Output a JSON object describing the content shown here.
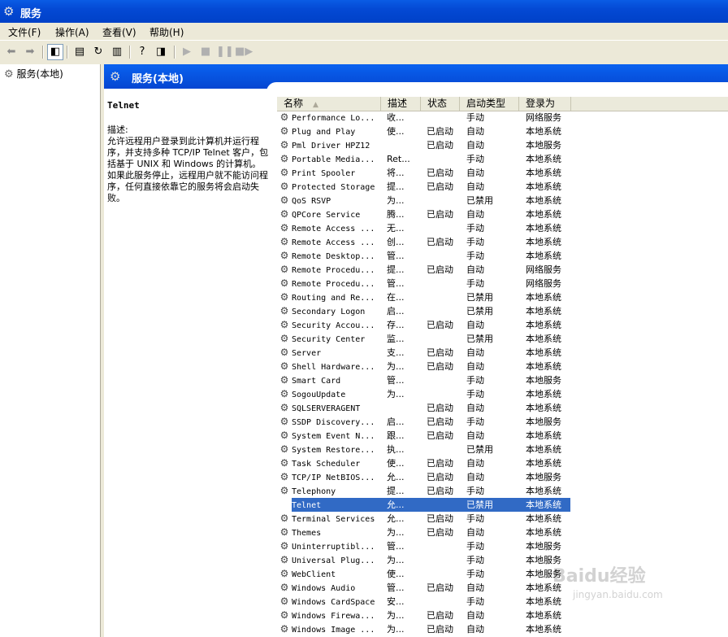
{
  "window": {
    "title": "服务"
  },
  "menu": [
    {
      "label": "文件(F)"
    },
    {
      "label": "操作(A)"
    },
    {
      "label": "查看(V)"
    },
    {
      "label": "帮助(H)"
    }
  ],
  "tree": {
    "item": "服务(本地)"
  },
  "banner": {
    "title": "服务(本地)"
  },
  "detail": {
    "title": "Telnet",
    "label": "描述:",
    "text": "允许远程用户登录到此计算机并运行程序，并支持多种 TCP/IP Telnet 客户，包括基于 UNIX 和 Windows 的计算机。如果此服务停止，远程用户就不能访问程序，任何直接依靠它的服务将会启动失败。"
  },
  "columns": {
    "name": "名称",
    "desc": "描述",
    "status": "状态",
    "startup": "启动类型",
    "logon": "登录为"
  },
  "services": [
    {
      "name": "Performance Lo...",
      "desc": "收...",
      "status": "",
      "startup": "手动",
      "logon": "网络服务"
    },
    {
      "name": "Plug and Play",
      "desc": "使...",
      "status": "已启动",
      "startup": "自动",
      "logon": "本地系统"
    },
    {
      "name": "Pml Driver HPZ12",
      "desc": "",
      "status": "已启动",
      "startup": "自动",
      "logon": "本地服务"
    },
    {
      "name": "Portable Media...",
      "desc": "Ret...",
      "status": "",
      "startup": "手动",
      "logon": "本地系统"
    },
    {
      "name": "Print Spooler",
      "desc": "将...",
      "status": "已启动",
      "startup": "自动",
      "logon": "本地系统"
    },
    {
      "name": "Protected Storage",
      "desc": "提...",
      "status": "已启动",
      "startup": "自动",
      "logon": "本地系统"
    },
    {
      "name": "QoS RSVP",
      "desc": "为...",
      "status": "",
      "startup": "已禁用",
      "logon": "本地系统"
    },
    {
      "name": "QPCore Service",
      "desc": "腾...",
      "status": "已启动",
      "startup": "自动",
      "logon": "本地系统"
    },
    {
      "name": "Remote Access ...",
      "desc": "无...",
      "status": "",
      "startup": "手动",
      "logon": "本地系统"
    },
    {
      "name": "Remote Access ...",
      "desc": "创...",
      "status": "已启动",
      "startup": "手动",
      "logon": "本地系统"
    },
    {
      "name": "Remote Desktop...",
      "desc": "管...",
      "status": "",
      "startup": "手动",
      "logon": "本地系统"
    },
    {
      "name": "Remote Procedu...",
      "desc": "提...",
      "status": "已启动",
      "startup": "自动",
      "logon": "网络服务"
    },
    {
      "name": "Remote Procedu...",
      "desc": "管...",
      "status": "",
      "startup": "手动",
      "logon": "网络服务"
    },
    {
      "name": "Routing and Re...",
      "desc": "在...",
      "status": "",
      "startup": "已禁用",
      "logon": "本地系统"
    },
    {
      "name": "Secondary Logon",
      "desc": "启...",
      "status": "",
      "startup": "已禁用",
      "logon": "本地系统"
    },
    {
      "name": "Security Accou...",
      "desc": "存...",
      "status": "已启动",
      "startup": "自动",
      "logon": "本地系统"
    },
    {
      "name": "Security Center",
      "desc": "监...",
      "status": "",
      "startup": "已禁用",
      "logon": "本地系统"
    },
    {
      "name": "Server",
      "desc": "支...",
      "status": "已启动",
      "startup": "自动",
      "logon": "本地系统"
    },
    {
      "name": "Shell Hardware...",
      "desc": "为...",
      "status": "已启动",
      "startup": "自动",
      "logon": "本地系统"
    },
    {
      "name": "Smart Card",
      "desc": "管...",
      "status": "",
      "startup": "手动",
      "logon": "本地服务"
    },
    {
      "name": "SogouUpdate",
      "desc": "为...",
      "status": "",
      "startup": "手动",
      "logon": "本地系统"
    },
    {
      "name": "SQLSERVERAGENT",
      "desc": "",
      "status": "已启动",
      "startup": "自动",
      "logon": "本地系统"
    },
    {
      "name": "SSDP Discovery...",
      "desc": "启...",
      "status": "已启动",
      "startup": "手动",
      "logon": "本地服务"
    },
    {
      "name": "System Event N...",
      "desc": "跟...",
      "status": "已启动",
      "startup": "自动",
      "logon": "本地系统"
    },
    {
      "name": "System Restore...",
      "desc": "执...",
      "status": "",
      "startup": "已禁用",
      "logon": "本地系统"
    },
    {
      "name": "Task Scheduler",
      "desc": "使...",
      "status": "已启动",
      "startup": "自动",
      "logon": "本地系统"
    },
    {
      "name": "TCP/IP NetBIOS...",
      "desc": "允...",
      "status": "已启动",
      "startup": "自动",
      "logon": "本地服务"
    },
    {
      "name": "Telephony",
      "desc": "提...",
      "status": "已启动",
      "startup": "手动",
      "logon": "本地系统"
    },
    {
      "name": "Telnet",
      "desc": "允...",
      "status": "",
      "startup": "已禁用",
      "logon": "本地系统",
      "selected": true
    },
    {
      "name": "Terminal Services",
      "desc": "允...",
      "status": "已启动",
      "startup": "手动",
      "logon": "本地系统"
    },
    {
      "name": "Themes",
      "desc": "为...",
      "status": "已启动",
      "startup": "自动",
      "logon": "本地系统"
    },
    {
      "name": "Uninterruptibl...",
      "desc": "管...",
      "status": "",
      "startup": "手动",
      "logon": "本地服务"
    },
    {
      "name": "Universal Plug...",
      "desc": "为...",
      "status": "",
      "startup": "手动",
      "logon": "本地服务"
    },
    {
      "name": "WebClient",
      "desc": "使...",
      "status": "",
      "startup": "手动",
      "logon": "本地服务"
    },
    {
      "name": "Windows Audio",
      "desc": "管...",
      "status": "已启动",
      "startup": "自动",
      "logon": "本地系统"
    },
    {
      "name": "Windows CardSpace",
      "desc": "安...",
      "status": "",
      "startup": "手动",
      "logon": "本地系统"
    },
    {
      "name": "Windows Firewa...",
      "desc": "为...",
      "status": "已启动",
      "startup": "自动",
      "logon": "本地系统"
    },
    {
      "name": "Windows Image ...",
      "desc": "为...",
      "status": "已启动",
      "startup": "自动",
      "logon": "本地系统"
    }
  ],
  "watermark": {
    "brand": "Baidu经验",
    "url": "jingyan.baidu.com"
  },
  "colors": {
    "title_bar": "#0449d4",
    "selection": "#316ac5",
    "face": "#ece9d8"
  },
  "icons": {
    "window": "gear-icon",
    "service": "gear-icon"
  }
}
